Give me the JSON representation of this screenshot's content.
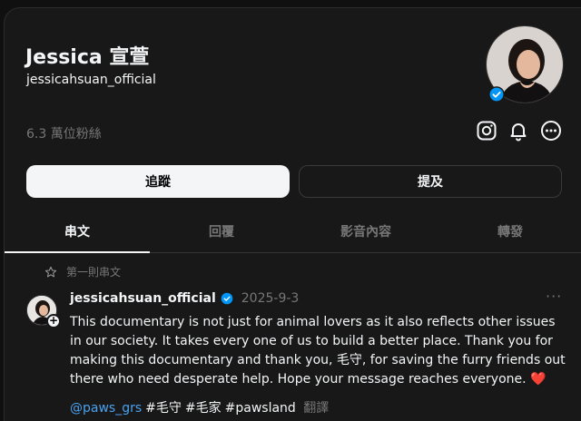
{
  "profile": {
    "display_name": "Jessica 宣萱",
    "username": "jessicahsuan_official",
    "followers": "6.3 萬位粉絲",
    "avatar_icon": "profile-photo",
    "verified_icon": "verified-badge-icon"
  },
  "header_icons": [
    "instagram-icon",
    "bell-icon",
    "more-icon"
  ],
  "buttons": {
    "follow_label": "追蹤",
    "mention_label": "提及"
  },
  "tabs": [
    {
      "label": "串文",
      "active": true
    },
    {
      "label": "回覆",
      "active": false
    },
    {
      "label": "影音內容",
      "active": false
    },
    {
      "label": "轉發",
      "active": false
    }
  ],
  "pinned_label": "第一則串文",
  "post": {
    "username": "jessicahsuan_official",
    "date": "2025-9-3",
    "text": "This documentary is not just for animal lovers as it also reflects other issues in our society. It takes every one of us to build a better place. Thank you for making this documentary and thank you, 毛守, for saving the furry friends out there who need desperate help. Hope your message reaches everyone. ❤️",
    "mention": "@paws_grs",
    "tags": [
      "#毛守",
      "#毛家",
      "#pawsland"
    ],
    "translate_label": "翻譯",
    "more_label": "···"
  },
  "colors": {
    "background": "#181818",
    "text": "#f3f5f7",
    "muted": "#777777",
    "link": "#4aa2f0",
    "verified": "#0095f6"
  }
}
